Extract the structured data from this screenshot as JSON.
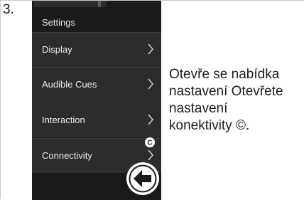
{
  "step": {
    "number": "3."
  },
  "screen": {
    "title": "Settings",
    "menu": [
      {
        "label": "Display"
      },
      {
        "label": "Audible Cues"
      },
      {
        "label": "Interaction"
      },
      {
        "label": "Connectivity"
      }
    ],
    "connectivity_marker": "C",
    "back_icon": "arrow-left-circle-icon"
  },
  "caption": {
    "lines": [
      "Otevře se nabídka",
      "nastavení Otevřete",
      "nastavení",
      "konektivity ©."
    ]
  },
  "colors": {
    "screen_bg": "#1a1a1a",
    "item_bg": "#2c2c2c",
    "text_light": "#ececec",
    "back_button": "#ffffff"
  }
}
